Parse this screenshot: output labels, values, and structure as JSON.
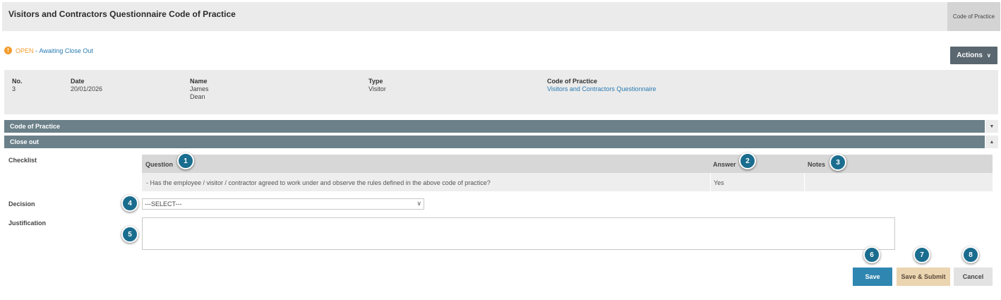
{
  "header": {
    "title": "Visitors and Contractors Questionnaire Code of Practice",
    "tab_label": "Code of Practice"
  },
  "status": {
    "icon": "exclamation-icon",
    "state": "OPEN",
    "separator": " - ",
    "detail": "Awaiting Close Out"
  },
  "actions": {
    "label": "Actions",
    "icon": "chevron-down-icon"
  },
  "info": {
    "no_label": "No.",
    "no_value": "3",
    "date_label": "Date",
    "date_value": "20/01/2026",
    "name_label": "Name",
    "name_first": "James",
    "name_last": "Dean",
    "type_label": "Type",
    "type_value": "Visitor",
    "cop_label": "Code of Practice",
    "cop_value": "Visitors and Contractors Questionnaire"
  },
  "sections": {
    "code_of_practice": "Code of Practice",
    "close_out": "Close out"
  },
  "form": {
    "checklist_label": "Checklist",
    "decision_label": "Decision",
    "justification_label": "Justification",
    "decision_value": "---SELECT---",
    "justification_value": ""
  },
  "checklist": {
    "headers": {
      "question": "Question",
      "answer": "Answer",
      "notes": "Notes"
    },
    "rows": [
      {
        "question": "- Has the employee / visitor / contractor agreed to work under and observe the rules defined in the above code of practice?",
        "answer": "Yes",
        "notes": ""
      }
    ]
  },
  "buttons": {
    "save": "Save",
    "save_submit": "Save & Submit",
    "cancel": "Cancel"
  },
  "callouts": [
    "1",
    "2",
    "3",
    "4",
    "5",
    "6",
    "7",
    "8"
  ],
  "colors": {
    "section_bar": "#6b8089",
    "accent_blue": "#2f86b0",
    "status_orange": "#f39c2d",
    "submit_button": "#ebd4b0",
    "actions_button": "#5a6770",
    "callout": "#1a6d8e"
  }
}
